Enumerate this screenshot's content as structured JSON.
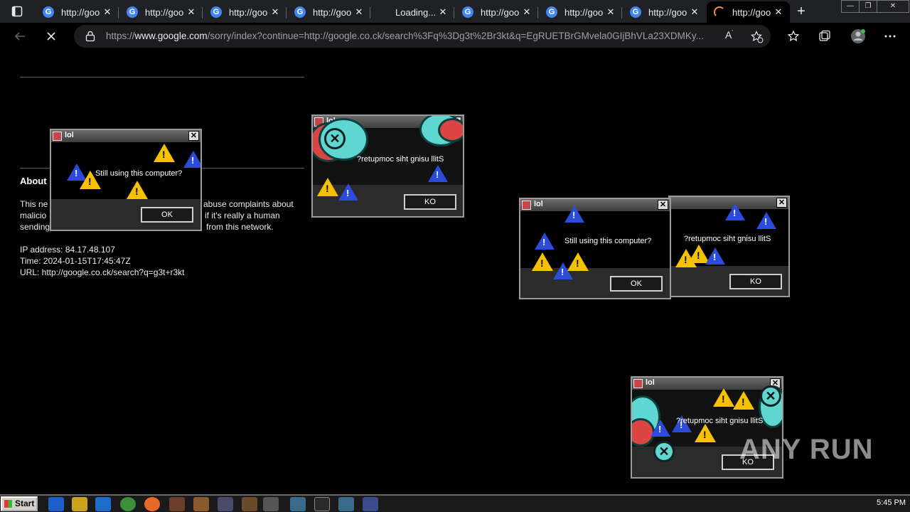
{
  "browser": {
    "tabs": [
      {
        "title": "http://goo",
        "icon": "google-g-icon"
      },
      {
        "title": "http://goo",
        "icon": "google-g-icon"
      },
      {
        "title": "http://goo",
        "icon": "google-g-icon"
      },
      {
        "title": "http://goo",
        "icon": "google-g-icon"
      },
      {
        "title": "Loading...",
        "icon": "none"
      },
      {
        "title": "http://goo",
        "icon": "google-g-icon"
      },
      {
        "title": "http://goo",
        "icon": "google-g-icon"
      },
      {
        "title": "http://goo",
        "icon": "google-g-icon"
      },
      {
        "title": "http://goo",
        "icon": "loading-spinner-icon"
      }
    ],
    "address": {
      "prefix": "https://",
      "host": "www.google.com",
      "path": "/sorry/index?continue=http://google.co.ck/search%3Fq%3Dg3t%2Br3kt&q=EgRUETBrGMvela0GIjBhVLa23XDMKy..."
    }
  },
  "page": {
    "about_heading": "About",
    "line1_left": "This ne",
    "line1_right": "abuse complaints about",
    "line2_left": "malicio",
    "line2_right": "if it's really a human",
    "line3_left": "sending",
    "line3_right": "from this network.",
    "ip": "IP address: 84.17.48.107",
    "time": "Time: 2024-01-15T17:45:47Z",
    "url": "URL: http://google.co.ck/search?q=g3t+r3kt"
  },
  "dialogs": [
    {
      "title": "lol",
      "message": "Still using this computer?",
      "button": "OK"
    },
    {
      "title": "lol",
      "message": "?retupmoc siht gnisu llitS",
      "button": "KO"
    },
    {
      "title": "lol",
      "message": "Still using this computer?",
      "button": "OK"
    },
    {
      "title": "",
      "message": "?retupmoc siht gnisu llitS",
      "button": "KO"
    },
    {
      "title": "lol",
      "message": "?retupmoc siht gnisu llitS",
      "button": "KO"
    }
  ],
  "taskbar": {
    "start_label": "Start",
    "clock": "5:45 PM"
  },
  "watermark": "ANY RUN",
  "colors": {
    "warning": "#f6c200",
    "info_blue": "#2c4bd8",
    "error_cyan": "#5fd7d0"
  }
}
